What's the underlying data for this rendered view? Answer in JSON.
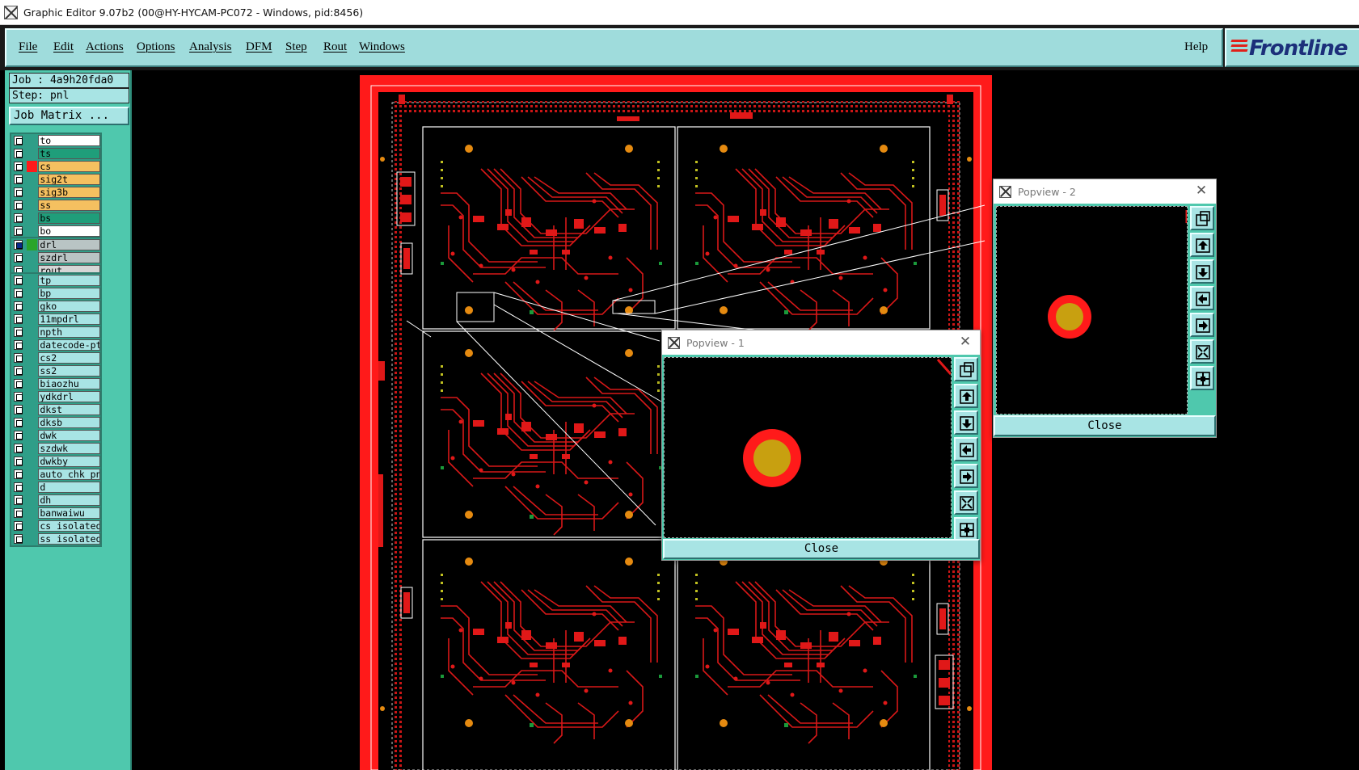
{
  "window": {
    "title": "Graphic Editor 9.07b2 (00@HY-HYCAM-PC072 - Windows, pid:8456)",
    "icon": "x-app-icon"
  },
  "menu": {
    "items": [
      "File",
      "Edit",
      "Actions",
      "Options",
      "Analysis",
      "DFM",
      "Step",
      "Rout",
      "Windows"
    ],
    "help": "Help",
    "logo": "Frontline"
  },
  "job": {
    "job_label": "Job : 4a9h20fda0",
    "step_label": "Step: pnl",
    "matrix_button": "Job Matrix ..."
  },
  "layers": {
    "board": [
      {
        "name": "to",
        "color": "#ffffff"
      },
      {
        "name": "ts",
        "color": "#1f9e7a"
      },
      {
        "name": "cs",
        "color": "#f5c060",
        "active": true
      },
      {
        "name": "sig2t",
        "color": "#f5c060"
      },
      {
        "name": "sig3b",
        "color": "#f5c060"
      },
      {
        "name": "ss",
        "color": "#f5c060"
      },
      {
        "name": "bs",
        "color": "#1f9e7a"
      },
      {
        "name": "bo",
        "color": "#ffffff"
      }
    ],
    "drill": [
      {
        "name": "drl",
        "color": "#b9c4c4",
        "active": true
      },
      {
        "name": "szdrl",
        "color": "#b9c4c4"
      },
      {
        "name": "rout",
        "color": "#d6d6d6"
      }
    ],
    "misc": [
      "tp",
      "bp",
      "gko",
      "11mpdrl",
      "npth",
      "datecode-pt",
      "cs2",
      "ss2",
      "biaozhu",
      "ydkdrl",
      "dkst",
      "dksb",
      "dwk",
      "szdwk",
      "dwkby",
      "auto_chk_pn",
      "d",
      "dh",
      "banwaiwu",
      "cs_isolated",
      "ss_isolated"
    ]
  },
  "popview1": {
    "title": "Popview - 1",
    "close_label": "Close"
  },
  "popview2": {
    "title": "Popview - 2",
    "close_label": "Close"
  },
  "colors": {
    "panel": "#4fc8ad",
    "menu": "#9fdcdc",
    "copper": "#ff1a1a",
    "pad_center": "#c8a010"
  }
}
